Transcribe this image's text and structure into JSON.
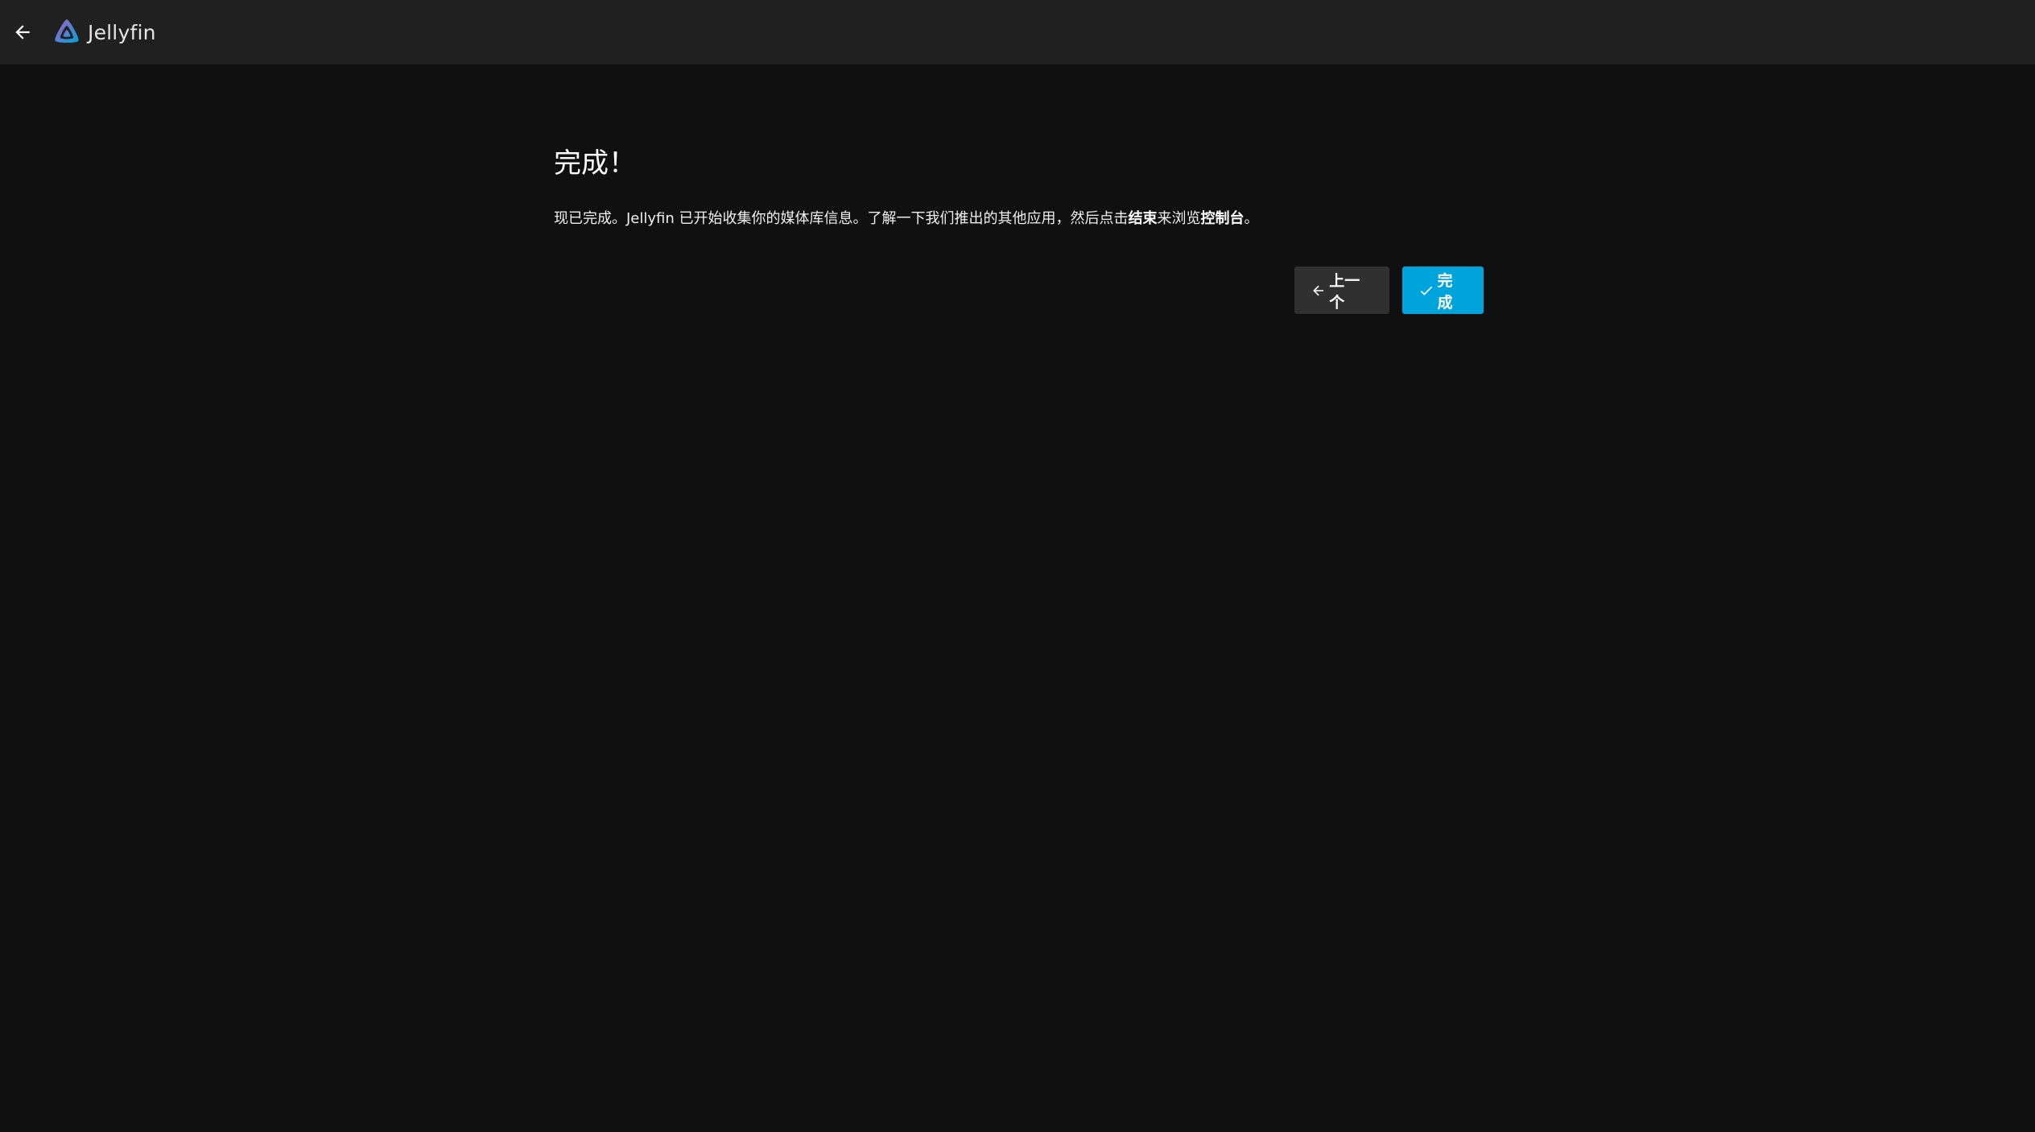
{
  "header": {
    "app_name": "Jellyfin",
    "back_icon": "arrow-left-icon",
    "logo_icon": "jellyfin-logo-icon"
  },
  "wizard": {
    "title": "完成！",
    "desc_part1": "现已完成。Jellyfin 已开始收集你的媒体库信息。了解一下我们推出的其他应用，然后点击",
    "desc_bold1": "结束",
    "desc_part2": "来浏览",
    "desc_bold2": "控制台",
    "desc_part3": "。",
    "prev_label": "上一个",
    "finish_label": "完成"
  },
  "colors": {
    "background": "#101010",
    "header": "#202020",
    "accent": "#00a4dc",
    "secondary_button": "#303030"
  }
}
